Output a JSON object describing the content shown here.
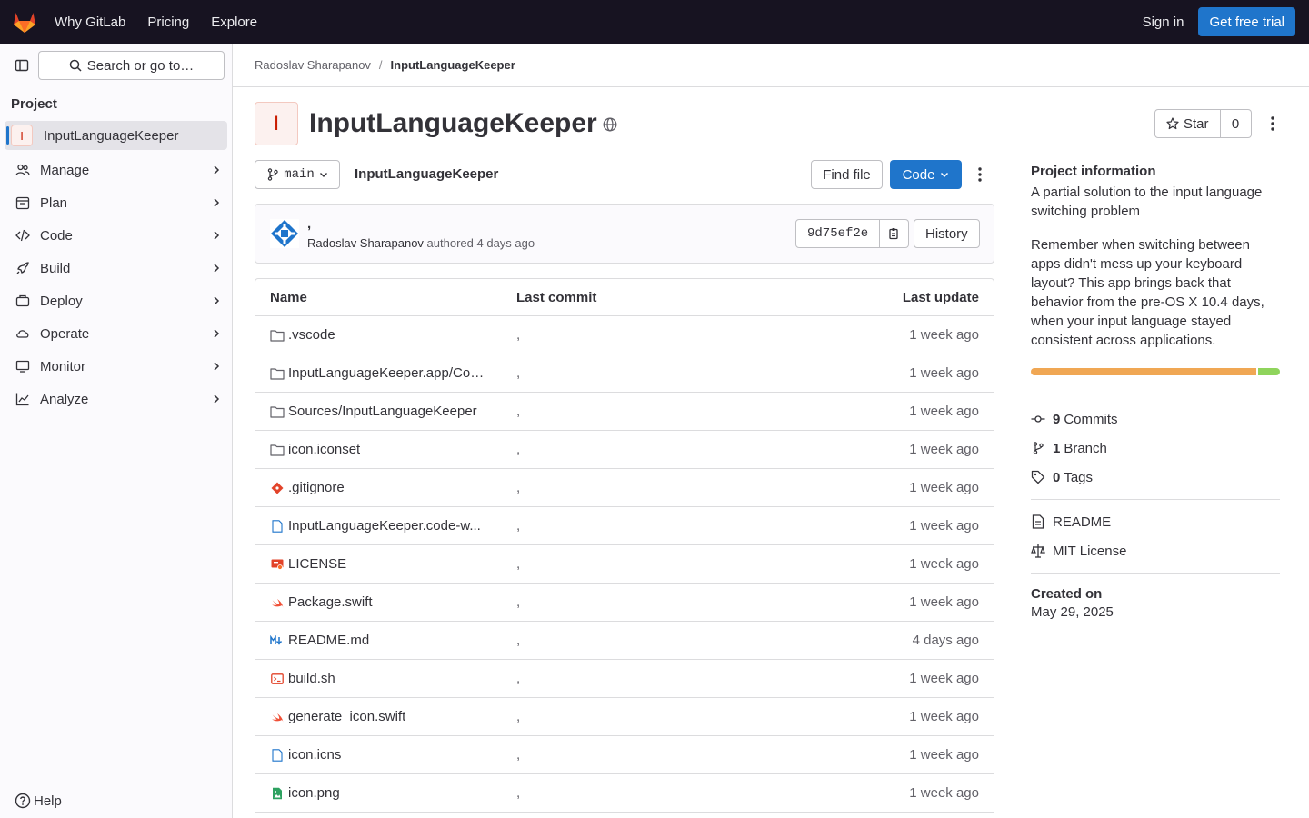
{
  "topnav": {
    "links": [
      "Why GitLab",
      "Pricing",
      "Explore"
    ],
    "signin": "Sign in",
    "trial": "Get free trial"
  },
  "sidebar": {
    "search": "Search or go to…",
    "section": "Project",
    "project_initial": "I",
    "project_name": "InputLanguageKeeper",
    "items": [
      {
        "label": "Manage",
        "icon": "users-icon"
      },
      {
        "label": "Plan",
        "icon": "calendar-icon"
      },
      {
        "label": "Code",
        "icon": "code-icon"
      },
      {
        "label": "Build",
        "icon": "rocket-icon"
      },
      {
        "label": "Deploy",
        "icon": "deploy-icon"
      },
      {
        "label": "Operate",
        "icon": "cloud-icon"
      },
      {
        "label": "Monitor",
        "icon": "monitor-icon"
      },
      {
        "label": "Analyze",
        "icon": "chart-icon"
      }
    ],
    "help": "Help"
  },
  "breadcrumb": {
    "owner": "Radoslav Sharapanov",
    "project": "InputLanguageKeeper"
  },
  "project": {
    "initial": "I",
    "title": "InputLanguageKeeper",
    "star_label": "Star",
    "star_count": "0"
  },
  "controls": {
    "branch": "main",
    "repo_name": "InputLanguageKeeper",
    "find_file": "Find file",
    "code": "Code"
  },
  "commit": {
    "title": ",",
    "author": "Radoslav Sharapanov",
    "authored": "authored",
    "time": "4 days ago",
    "sha": "9d75ef2e",
    "history": "History"
  },
  "files": {
    "headers": {
      "name": "Name",
      "last_commit": "Last commit",
      "last_update": "Last update"
    },
    "rows": [
      {
        "name": ".vscode",
        "type": "folder",
        "commit": ",",
        "updated": "1 week ago"
      },
      {
        "name": "InputLanguageKeeper.app/Con...",
        "type": "folder",
        "commit": ",",
        "updated": "1 week ago"
      },
      {
        "name": "Sources/InputLanguageKeeper",
        "type": "folder",
        "commit": ",",
        "updated": "1 week ago"
      },
      {
        "name": "icon.iconset",
        "type": "folder",
        "commit": ",",
        "updated": "1 week ago"
      },
      {
        "name": ".gitignore",
        "type": "git",
        "commit": ",",
        "updated": "1 week ago"
      },
      {
        "name": "InputLanguageKeeper.code-w...",
        "type": "file",
        "commit": ",",
        "updated": "1 week ago"
      },
      {
        "name": "LICENSE",
        "type": "license",
        "commit": ",",
        "updated": "1 week ago"
      },
      {
        "name": "Package.swift",
        "type": "swift",
        "commit": ",",
        "updated": "1 week ago"
      },
      {
        "name": "README.md",
        "type": "markdown",
        "commit": ",",
        "updated": "4 days ago"
      },
      {
        "name": "build.sh",
        "type": "shell",
        "commit": ",",
        "updated": "1 week ago"
      },
      {
        "name": "generate_icon.swift",
        "type": "swift",
        "commit": ",",
        "updated": "1 week ago"
      },
      {
        "name": "icon.icns",
        "type": "file",
        "commit": ",",
        "updated": "1 week ago"
      },
      {
        "name": "icon.png",
        "type": "image",
        "commit": ",",
        "updated": "1 week ago"
      }
    ]
  },
  "info": {
    "title": "Project information",
    "description": "A partial solution to the input language switching problem",
    "long": "Remember when switching between apps didn't mess up your keyboard layout? This app brings back that behavior from the pre-OS X 10.4 days, when your input language stayed consistent across applications.",
    "language_bar": [
      {
        "color": "#f0a754",
        "fraction": 0.91
      },
      {
        "color": "#8fd45c",
        "fraction": 0.09
      }
    ],
    "commits_count": "9",
    "commits_label": "Commits",
    "branches_count": "1",
    "branches_label": "Branch",
    "tags_count": "0",
    "tags_label": "Tags",
    "readme": "README",
    "license": "MIT License",
    "created_label": "Created on",
    "created": "May 29, 2025"
  },
  "colors": {
    "brand": "#1f75cb",
    "topbar": "#171321"
  }
}
